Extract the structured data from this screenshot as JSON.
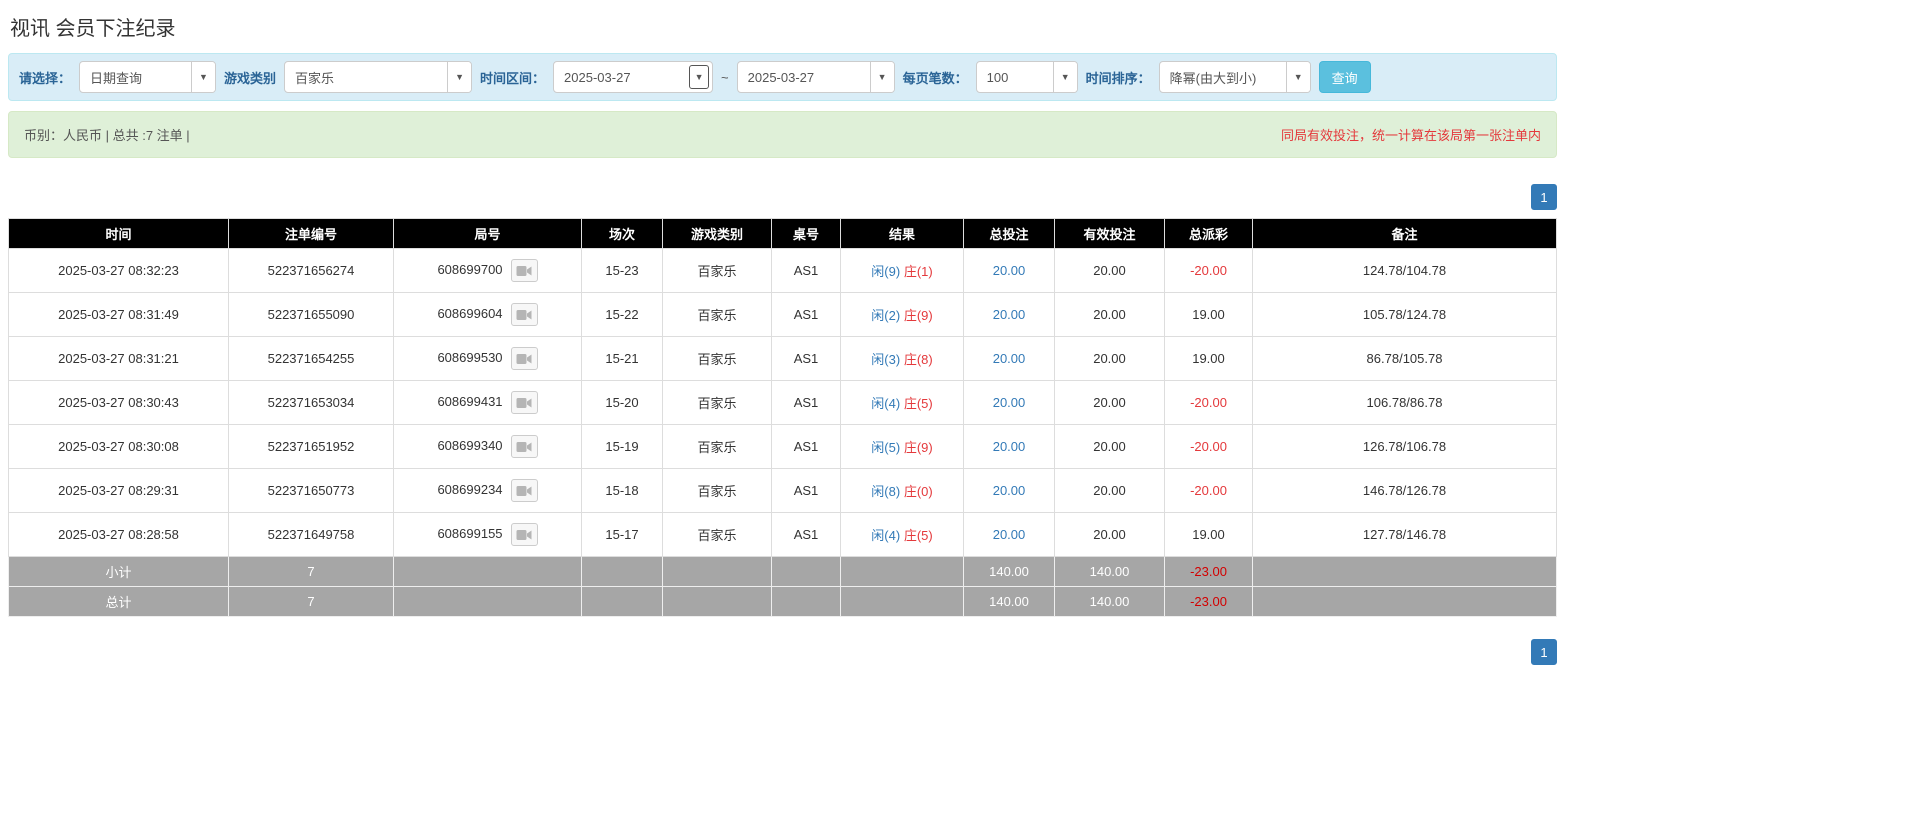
{
  "page": {
    "title": "视讯 会员下注纪录"
  },
  "filters": {
    "select_label": "请选择：",
    "select_value": "日期查询",
    "game_type_label": "游戏类别",
    "game_type_value": "百家乐",
    "time_range_label": "时间区间：",
    "date_from": "2025-03-27",
    "tilde": "~",
    "date_to": "2025-03-27",
    "page_size_label": "每页笔数：",
    "page_size_value": "100",
    "sort_label": "时间排序：",
    "sort_value": "降幂(由大到小)",
    "search_button": "查询",
    "caret_icon": "▼"
  },
  "summary": {
    "left": "币别：人民币 | 总共 :7 注单 |",
    "right": "同局有效投注，统一计算在该局第一张注单内"
  },
  "pagination": {
    "page": "1"
  },
  "table": {
    "headers": [
      "时间",
      "注单编号",
      "局号",
      "场次",
      "游戏类别",
      "桌号",
      "结果",
      "总投注",
      "有效投注",
      "总派彩",
      "备注"
    ],
    "rows": [
      {
        "time": "2025-03-27 08:32:23",
        "bet_id": "522371656274",
        "round_id": "608699700",
        "session": "15-23",
        "game": "百家乐",
        "table_no": "AS1",
        "player": "闲(9)",
        "banker": "庄(1)",
        "total_bet": "20.00",
        "valid_bet": "20.00",
        "payout": "-20.00",
        "note": "124.78/104.78"
      },
      {
        "time": "2025-03-27 08:31:49",
        "bet_id": "522371655090",
        "round_id": "608699604",
        "session": "15-22",
        "game": "百家乐",
        "table_no": "AS1",
        "player": "闲(2)",
        "banker": "庄(9)",
        "total_bet": "20.00",
        "valid_bet": "20.00",
        "payout": "19.00",
        "note": "105.78/124.78"
      },
      {
        "time": "2025-03-27 08:31:21",
        "bet_id": "522371654255",
        "round_id": "608699530",
        "session": "15-21",
        "game": "百家乐",
        "table_no": "AS1",
        "player": "闲(3)",
        "banker": "庄(8)",
        "total_bet": "20.00",
        "valid_bet": "20.00",
        "payout": "19.00",
        "note": "86.78/105.78"
      },
      {
        "time": "2025-03-27 08:30:43",
        "bet_id": "522371653034",
        "round_id": "608699431",
        "session": "15-20",
        "game": "百家乐",
        "table_no": "AS1",
        "player": "闲(4)",
        "banker": "庄(5)",
        "total_bet": "20.00",
        "valid_bet": "20.00",
        "payout": "-20.00",
        "note": "106.78/86.78"
      },
      {
        "time": "2025-03-27 08:30:08",
        "bet_id": "522371651952",
        "round_id": "608699340",
        "session": "15-19",
        "game": "百家乐",
        "table_no": "AS1",
        "player": "闲(5)",
        "banker": "庄(9)",
        "total_bet": "20.00",
        "valid_bet": "20.00",
        "payout": "-20.00",
        "note": "126.78/106.78"
      },
      {
        "time": "2025-03-27 08:29:31",
        "bet_id": "522371650773",
        "round_id": "608699234",
        "session": "15-18",
        "game": "百家乐",
        "table_no": "AS1",
        "player": "闲(8)",
        "banker": "庄(0)",
        "total_bet": "20.00",
        "valid_bet": "20.00",
        "payout": "-20.00",
        "note": "146.78/126.78"
      },
      {
        "time": "2025-03-27 08:28:58",
        "bet_id": "522371649758",
        "round_id": "608699155",
        "session": "15-17",
        "game": "百家乐",
        "table_no": "AS1",
        "player": "闲(4)",
        "banker": "庄(5)",
        "total_bet": "20.00",
        "valid_bet": "20.00",
        "payout": "19.00",
        "note": "127.78/146.78"
      }
    ],
    "footer": [
      {
        "label": "小计",
        "count": "7",
        "total_bet": "140.00",
        "valid_bet": "140.00",
        "payout": "-23.00"
      },
      {
        "label": "总计",
        "count": "7",
        "total_bet": "140.00",
        "valid_bet": "140.00",
        "payout": "-23.00"
      }
    ]
  }
}
